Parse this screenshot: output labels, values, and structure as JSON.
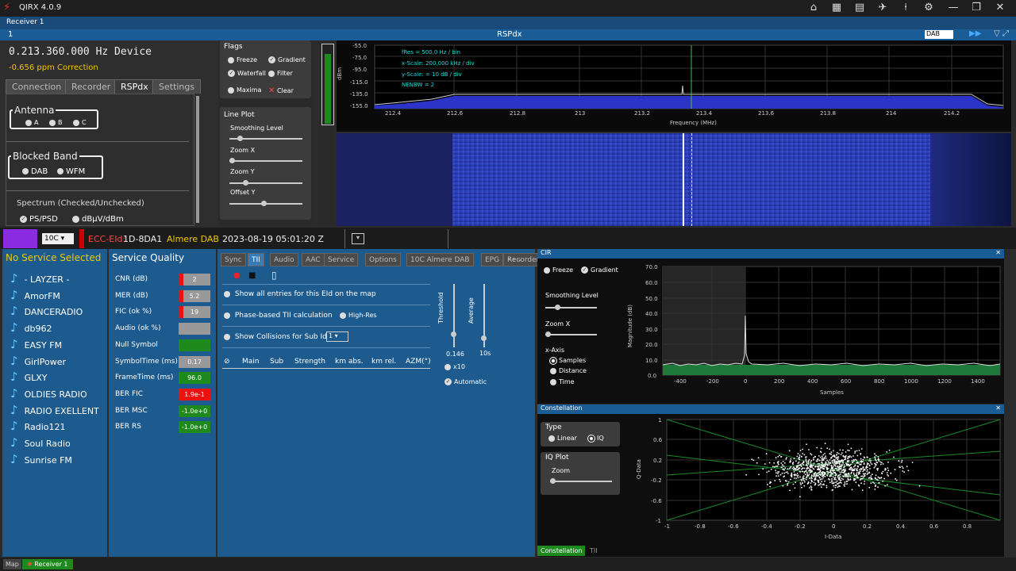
{
  "app": {
    "title": "QIRX 4.0.9",
    "receiver_tab": "Receiver 1",
    "panel_index": "1",
    "rsp_title": "RSPdx",
    "mode_select": "DAB"
  },
  "device": {
    "frequency": "0.213.360.000 Hz Device",
    "ppm": "-0.656 ppm Correction",
    "tabs": [
      "Connection",
      "Recorder",
      "RSPdx",
      "Settings"
    ],
    "antenna_label": "Antenna",
    "antenna_options": [
      "A",
      "B",
      "C"
    ],
    "blocked_label": "Blocked Band",
    "blocked_options": [
      "DAB",
      "WFM"
    ],
    "spectrum_label": "Spectrum (Checked/Unchecked)",
    "spectrum_options": [
      "PS/PSD",
      "dBµV/dBm"
    ]
  },
  "flags": {
    "title": "Flags",
    "items": [
      "Freeze",
      "Gradient",
      "Waterfall",
      "Filter",
      "Maxima",
      "Clear"
    ],
    "lineplot_title": "Line Plot",
    "sliders": [
      "Smoothing Level",
      "Zoom X",
      "Zoom Y",
      "Offset Y"
    ]
  },
  "spectrum": {
    "y_ticks": [
      "-55.0",
      "-75.0",
      "-95.0",
      "-115.0",
      "-135.0",
      "-155.0"
    ],
    "y_unit": "dBm",
    "x_ticks": [
      "212.4",
      "212.6",
      "212.8",
      "213",
      "213.2",
      "213.4",
      "213.6",
      "213.8",
      "214",
      "214.2"
    ],
    "x_label": "Frequency (MHz)",
    "info": [
      "fRes = 500,0 Hz / bin",
      "x-Scale: 200,000 kHz / div",
      "y-Scale: = 10 dB / div",
      "NENBW = 2"
    ]
  },
  "status": {
    "channel": "10C",
    "ecc_label": "ECC-EId:",
    "ecc_value": "1D-8DA1",
    "ensemble": "Almere DAB",
    "datetime": "2023-08-19  05:01:20 Z"
  },
  "services": {
    "header": "No Service Selected",
    "items": [
      "- LAYZER -",
      "AmorFM",
      "DANCERADIO",
      "db962",
      "EASY FM",
      "GirlPower",
      "GLXY",
      "OLDIES RADIO",
      "RADIO EXELLENT",
      "Radio121",
      "Soul Radio",
      "Sunrise FM"
    ]
  },
  "quality": {
    "header": "Service Quality",
    "rows": [
      {
        "label": "CNR (dB)",
        "value": "2",
        "color": "#999999",
        "level": 0.08
      },
      {
        "label": "MER (dB)",
        "value": "5.2",
        "color": "#999999",
        "level": 0.15
      },
      {
        "label": "FIC (ok %)",
        "value": "19",
        "color": "#999999",
        "level": 0.19
      },
      {
        "label": "Audio (ok %)",
        "value": "",
        "color": "#999999",
        "level": 0
      },
      {
        "label": "Null Symbol",
        "value": "",
        "color": "#1e8a1e",
        "level": 1
      },
      {
        "label": "SymbolTime (ms)",
        "value": "0.17",
        "color": "#999999",
        "level": 0
      },
      {
        "label": "FrameTime (ms)",
        "value": "96.0",
        "color": "#1e8a1e",
        "level": 1
      },
      {
        "label": "BER FIC",
        "value": "1.9e-1",
        "color": "#ee1111",
        "level": 1
      },
      {
        "label": "BER MSC",
        "value": "-1.0e+0",
        "color": "#1e8a1e",
        "level": 1
      },
      {
        "label": "BER RS",
        "value": "-1.0e+0",
        "color": "#1e8a1e",
        "level": 1
      }
    ]
  },
  "tii": {
    "tabs": [
      "Sync",
      "TII",
      "Audio",
      "AAC",
      "Service",
      "Options",
      "10C Almere DAB",
      "EPG",
      "Recorders"
    ],
    "opt1": "Show all entries for this EId on the map",
    "opt2": "Phase-based TII calculation",
    "opt2b": "High-Res",
    "opt3": "Show Collisions for Sub Id",
    "subid": "1",
    "cols": [
      "Main",
      "Sub",
      "Strength",
      "km abs.",
      "km rel.",
      "AZM(°)"
    ],
    "threshold": "Threshold",
    "average": "Average",
    "thr_val": "0.146",
    "avg_val": "10s",
    "x10": "x10",
    "automatic": "Automatic"
  },
  "cir": {
    "title": "CIR",
    "freeze": "Freeze",
    "gradient": "Gradient",
    "smoothing": "Smoothing Level",
    "zoomx": "Zoom X",
    "xaxis": "x-Axis",
    "xopts": [
      "Samples",
      "Distance",
      "Time"
    ],
    "y_ticks": [
      "70.0",
      "60.0",
      "50.0",
      "40.0",
      "30.0",
      "20.0",
      "10.0",
      "0.0"
    ],
    "y_label": "Magnitude (dB)",
    "x_ticks": [
      "-400",
      "-200",
      "0",
      "200",
      "400",
      "600",
      "800",
      "1000",
      "1200",
      "1400"
    ],
    "x_label": "Samples"
  },
  "const": {
    "title": "Constellation",
    "type": "Type",
    "types": [
      "Linear",
      "IQ"
    ],
    "iqplot": "IQ Plot",
    "zoom": "Zoom",
    "y_ticks": [
      "1",
      "0.6",
      "0.2",
      "-0.2",
      "-0.6",
      "-1"
    ],
    "y_label": "Q-Data",
    "x_ticks": [
      "-1",
      "-0.8",
      "-0.6",
      "-0.4",
      "-0.2",
      "0",
      "0.2",
      "0.4",
      "0.6",
      "0.8"
    ],
    "x_label": "I-Data",
    "tabs": [
      "Constellation",
      "TII"
    ]
  },
  "bottom": {
    "tabs": [
      "Map",
      "Receiver 1"
    ]
  },
  "colors": {
    "accent": "#1a5c96",
    "panel": "#1d5a8e",
    "yellow": "#f0c800",
    "green": "#1e8a1e"
  }
}
